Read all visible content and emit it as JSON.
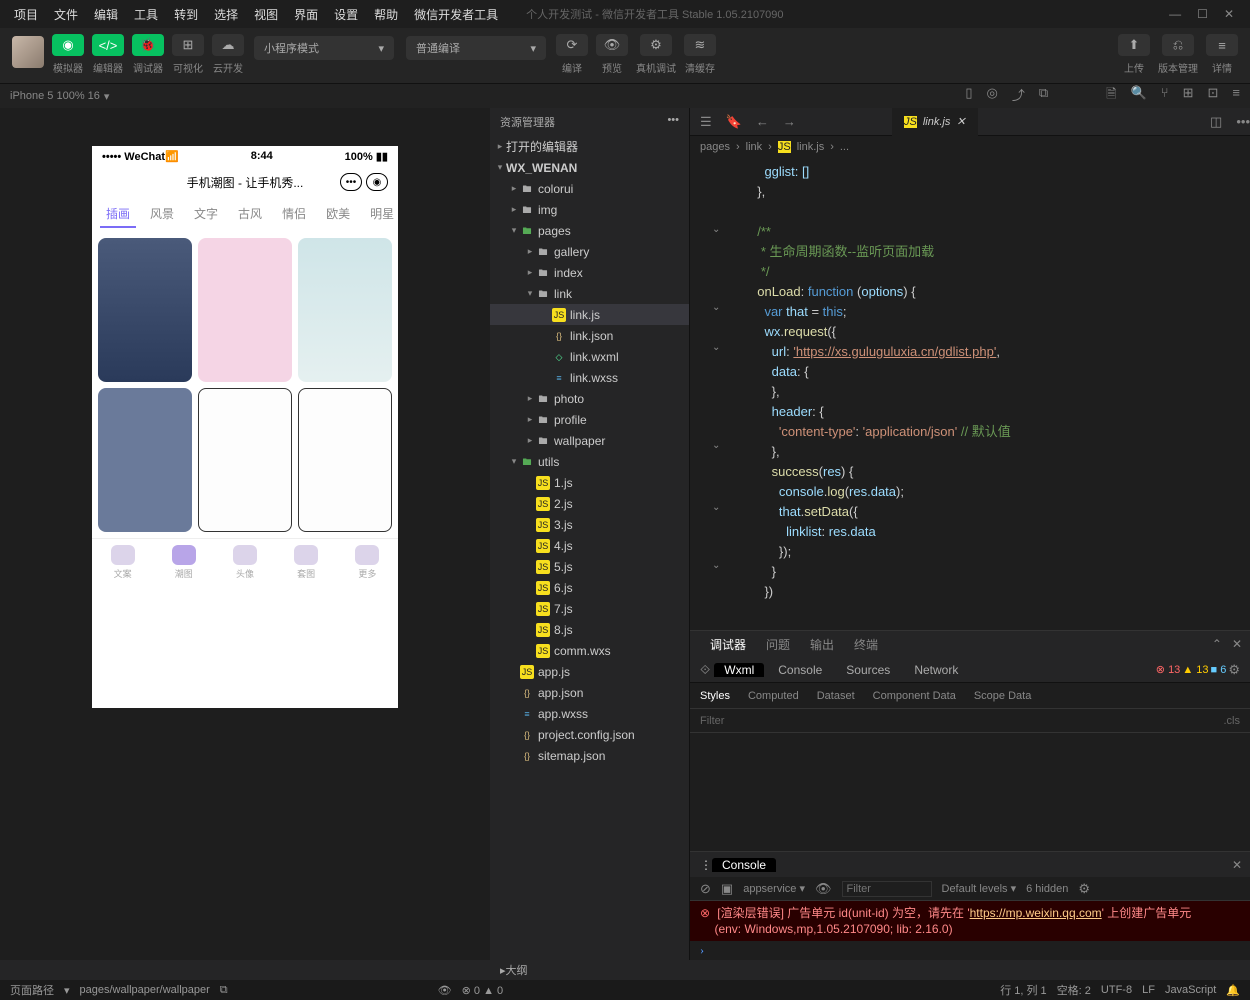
{
  "menubar": [
    "项目",
    "文件",
    "编辑",
    "工具",
    "转到",
    "选择",
    "视图",
    "界面",
    "设置",
    "帮助",
    "微信开发者工具"
  ],
  "window_title": "个人开发测试 - 微信开发者工具 Stable 1.05.2107090",
  "toolbar": {
    "sim": "模拟器",
    "editor": "编辑器",
    "debugger": "调试器",
    "visual": "可视化",
    "cloud": "云开发",
    "mode": "小程序模式",
    "compile": "普通编译",
    "compile2": "编译",
    "preview": "预览",
    "remote": "真机调试",
    "clear": "清缓存",
    "upload": "上传",
    "version": "版本管理",
    "detail": "详情"
  },
  "devicebar": "iPhone 5 100% 16",
  "phone": {
    "carrier": "••••• WeChat",
    "time": "8:44",
    "battery": "100%",
    "title": "手机潮图 - 让手机秀...",
    "tabs": [
      "插画",
      "风景",
      "文字",
      "古风",
      "情侣",
      "欧美",
      "明星"
    ],
    "bottom": [
      "文案",
      "潮图",
      "头像",
      "套图",
      "更多"
    ]
  },
  "explorer": {
    "title": "资源管理器",
    "open_editors": "打开的编辑器",
    "project": "WX_WENAN",
    "items": {
      "colorui": "colorui",
      "img": "img",
      "pages": "pages",
      "gallery": "gallery",
      "index": "index",
      "link": "link",
      "linkjs": "link.js",
      "linkjson": "link.json",
      "linkwxml": "link.wxml",
      "linkwxss": "link.wxss",
      "photo": "photo",
      "profile": "profile",
      "wallpaper": "wallpaper",
      "utils": "utils",
      "u1": "1.js",
      "u2": "2.js",
      "u3": "3.js",
      "u4": "4.js",
      "u5": "5.js",
      "u6": "6.js",
      "u7": "7.js",
      "u8": "8.js",
      "comm": "comm.wxs",
      "appjs": "app.js",
      "appjson": "app.json",
      "appwxss": "app.wxss",
      "pconfig": "project.config.json",
      "sitemap": "sitemap.json"
    }
  },
  "editor": {
    "tabfile": "link.js",
    "crumb": [
      "pages",
      "link",
      "link.js",
      "..."
    ],
    "code": {
      "l1": "    gglist: []",
      "l2": "  },",
      "c1": "  /**",
      "c2": "   * 生命周期函数--监听页面加载",
      "c3": "   */",
      "fn1": "onLoad",
      "fn1a": "function",
      "fn1p": "options",
      "var1": "var",
      "var1n": "that",
      "this": "this",
      "wx": "wx",
      "req": "request",
      "url_k": "url",
      "url_v": "'https://xs.guluguluxia.cn/gdlist.php'",
      "data_k": "data",
      "hdr_k": "header",
      "ct_k": "'content-type'",
      "ct_v": "'application/json'",
      "ct_c": "// 默认值",
      "suc": "success",
      "res": "res",
      "con": "console",
      "log": "log",
      "resd": "res.data",
      "sd": "setData",
      "ll": "linklist",
      "rd": "res.data"
    }
  },
  "debugger": {
    "tabs": [
      "调试器",
      "问题",
      "输出",
      "终端"
    ],
    "ins": [
      "Wxml",
      "Console",
      "Sources",
      "Network"
    ],
    "b_err": "13",
    "b_warn": "13",
    "b_info": "6",
    "styles": [
      "Styles",
      "Computed",
      "Dataset",
      "Component Data",
      "Scope Data"
    ],
    "filter": "Filter",
    "cls": ".cls",
    "console": "Console",
    "appservice": "appservice",
    "levels": "Default levels",
    "hidden": "6 hidden",
    "err1": "[渲染层错误] 广告单元 id(unit-id) 为空，请先在 '",
    "errlink": "https://mp.weixin.qq.com",
    "err1b": "' 上创建广告单元",
    "env": "(env: Windows,mp,1.05.2107090; lib: 2.16.0)"
  },
  "outline": "大纲",
  "status": {
    "pathlabel": "页面路径",
    "pathval": "pages/wallpaper/wallpaper",
    "errs": "0",
    "warns": "0",
    "loc": "行 1, 列 1",
    "spaces": "空格: 2",
    "enc": "UTF-8",
    "eol": "LF",
    "lang": "JavaScript"
  }
}
